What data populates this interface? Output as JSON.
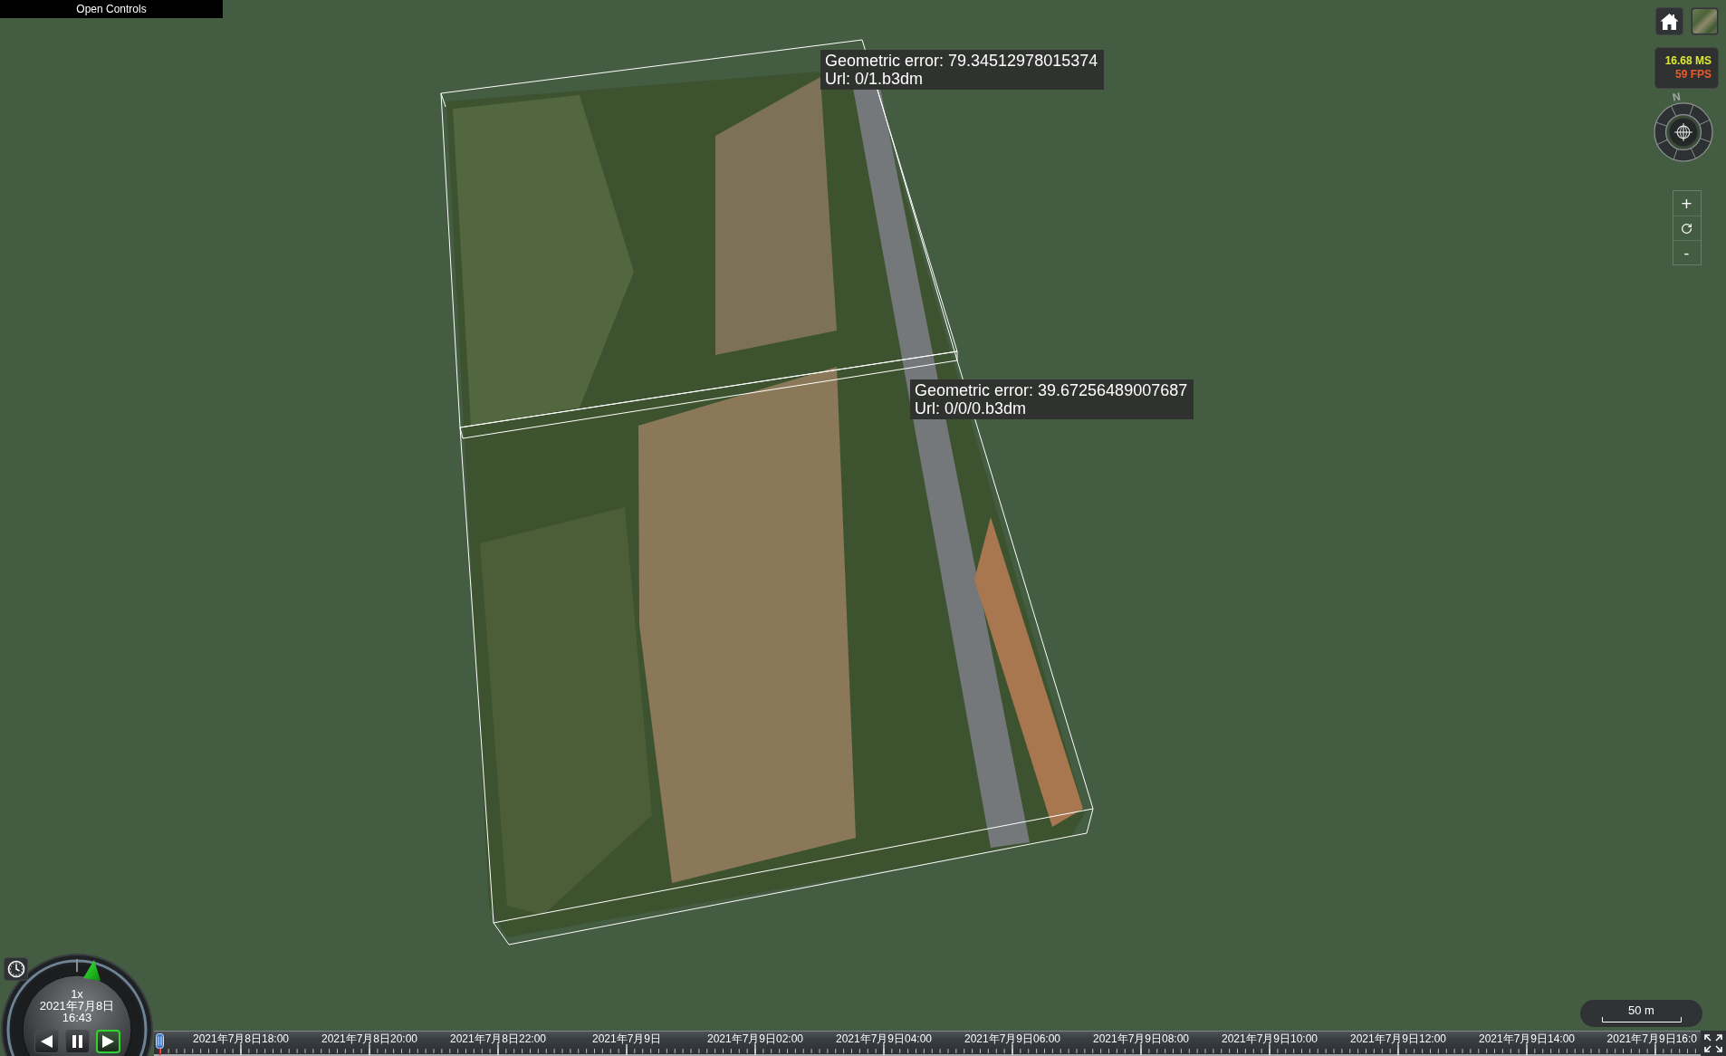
{
  "toolbar_toggle": {
    "label": "Open Controls"
  },
  "scene": {
    "tile_labels": [
      {
        "geometric_error": "Geometric error: 79.34512978015374",
        "url": "Url: 0/1.b3dm"
      },
      {
        "geometric_error": "Geometric error: 39.67256489007687",
        "url": "Url: 0/0/0.b3dm"
      }
    ]
  },
  "performance": {
    "frame_time": "16.68 MS",
    "frame_rate": "59 FPS"
  },
  "compass": {
    "north_label": "N"
  },
  "zoom_controls": {
    "zoom_in": "+",
    "zoom_out": "-"
  },
  "scale_bar": {
    "label": "50 m"
  },
  "animation": {
    "speed": "1x",
    "date": "2021年7月8日",
    "time": "16:43",
    "buttons": [
      {
        "kind": "reverse",
        "selected": false
      },
      {
        "kind": "pause",
        "selected": false
      },
      {
        "kind": "play",
        "selected": true
      }
    ]
  },
  "timeline": {
    "labels": [
      "2021年7月8日18:00",
      "2021年7月8日20:00",
      "2021年7月8日22:00",
      "2021年7月9日",
      "2021年7月9日02:00",
      "2021年7月9日04:00",
      "2021年7月9日06:00",
      "2021年7月9日08:00",
      "2021年7月9日10:00",
      "2021年7月9日12:00",
      "2021年7月9日14:00",
      "2021年7月9日16:0"
    ]
  }
}
